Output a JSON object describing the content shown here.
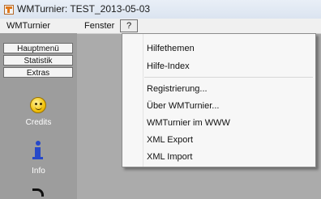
{
  "window": {
    "title": "WMTurnier: TEST_2013-05-03"
  },
  "menubar": {
    "items": [
      "WMTurnier",
      "Fenster",
      "?"
    ]
  },
  "sidebar": {
    "tabs": [
      "Hauptmenü",
      "Statistik",
      "Extras"
    ],
    "buttons": [
      {
        "label": "Credits",
        "icon": "smiley-icon"
      },
      {
        "label": "Info",
        "icon": "info-icon"
      }
    ]
  },
  "help_menu": {
    "items": [
      "Hilfethemen",
      "Hilfe-Index",
      "Registrierung...",
      "Über WMTurnier...",
      "WMTurnier im WWW",
      "XML Export",
      "XML Import"
    ]
  }
}
